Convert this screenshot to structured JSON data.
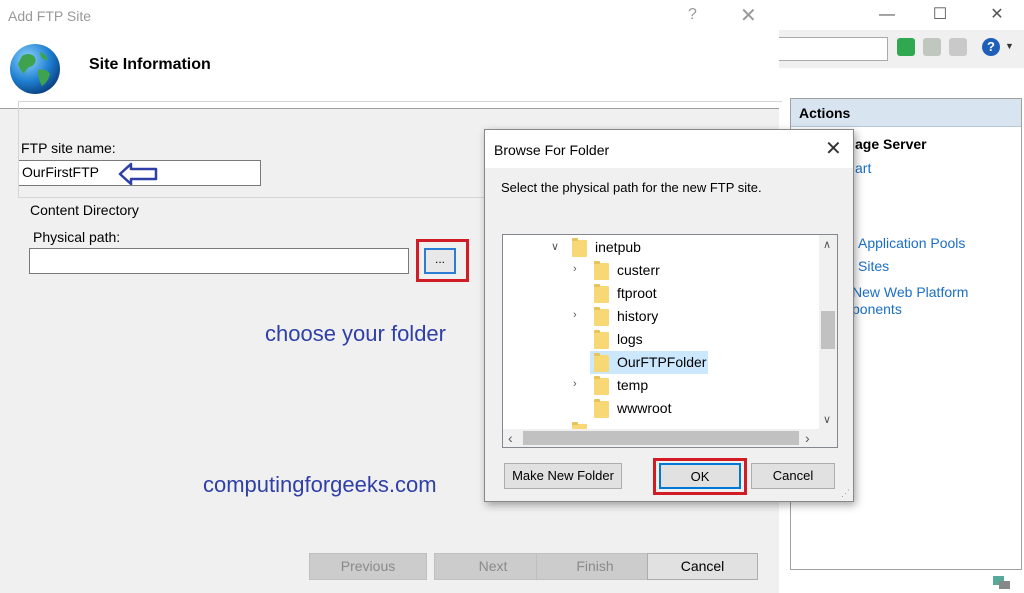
{
  "ftp_dialog": {
    "title": "Add FTP Site",
    "help_glyph": "?",
    "close_glyph": "✕",
    "heading": "Site Information",
    "site_name_label": "FTP site name:",
    "site_name_value": "OurFirstFTP",
    "content_directory_label": "Content Directory",
    "physical_path_label": "Physical path:",
    "physical_path_value": "",
    "browse_button_label": "...",
    "buttons": {
      "previous": "Previous",
      "next": "Next",
      "finish": "Finish",
      "cancel": "Cancel"
    }
  },
  "annotations": {
    "choose_folder": "choose your folder",
    "watermark": "computingforgeeks.com",
    "color": "#2f3fa8",
    "highlight_color": "#d21c25"
  },
  "browse_dialog": {
    "title": "Browse For Folder",
    "close_glyph": "✕",
    "instruction": "Select the physical path for the new FTP site.",
    "tree": [
      {
        "label": "inetpub",
        "expanded": true
      },
      {
        "label": "custerr",
        "expanded": false
      },
      {
        "label": "ftproot",
        "expanded": false
      },
      {
        "label": "history",
        "expanded": false
      },
      {
        "label": "logs",
        "expanded": false
      },
      {
        "label": "OurFTPFolder",
        "expanded": false,
        "selected": true
      },
      {
        "label": "temp",
        "expanded": false
      },
      {
        "label": "wwwroot",
        "expanded": false
      }
    ],
    "make_new_folder": "Make New Folder",
    "ok": "OK",
    "cancel": "Cancel"
  },
  "iis_window": {
    "actions_header": "Actions",
    "items": {
      "manage_server": "age Server",
      "restart": "art",
      "app_pools": "Application Pools",
      "sites": "Sites",
      "web_platform_line1": "New Web Platform",
      "web_platform_line2": "ponents"
    },
    "help_glyph": "?",
    "minimize_glyph": "—",
    "maximize_glyph": "☐",
    "close_glyph": "✕",
    "link_color": "#1a6ec7"
  }
}
